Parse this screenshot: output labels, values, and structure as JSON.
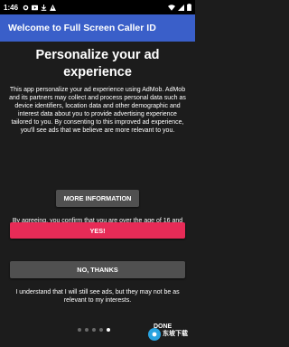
{
  "status_bar": {
    "time": "1:46",
    "left_icons": [
      "settings-icon",
      "play-icon",
      "download-icon",
      "alert-icon"
    ],
    "right_icons": [
      "wifi-icon",
      "signal-icon",
      "battery-icon"
    ]
  },
  "app_bar": {
    "title": "Welcome to Full Screen Caller ID",
    "color": "#3a5fc9"
  },
  "consent": {
    "heading": "Personalize your ad experience",
    "body": "This app personalize your ad experience using AdMob. AdMob and its partners may collect and process personal data such as device identifiers, location data and other demographic and interest data about you to provide advertising experience tailored to you. By consenting to this improved ad experience, you'll see ads that we believe are more relevant to you.",
    "more_info_label": "MORE INFORMATION",
    "agree_text": "By agreeing, you confirm that you are over the age of 16 and would like a personalized experience.",
    "yes_label": "YES!",
    "yes_color": "#e72b57",
    "no_label": "NO, THANKS",
    "footer_text": "I understand that I will still see ads, but they may not be as relevant to my interests."
  },
  "pager": {
    "page_count": 5,
    "active_page": 5,
    "done_label": "DONE"
  },
  "watermark": {
    "text": "东坡下载",
    "icon": "logo-icon"
  }
}
